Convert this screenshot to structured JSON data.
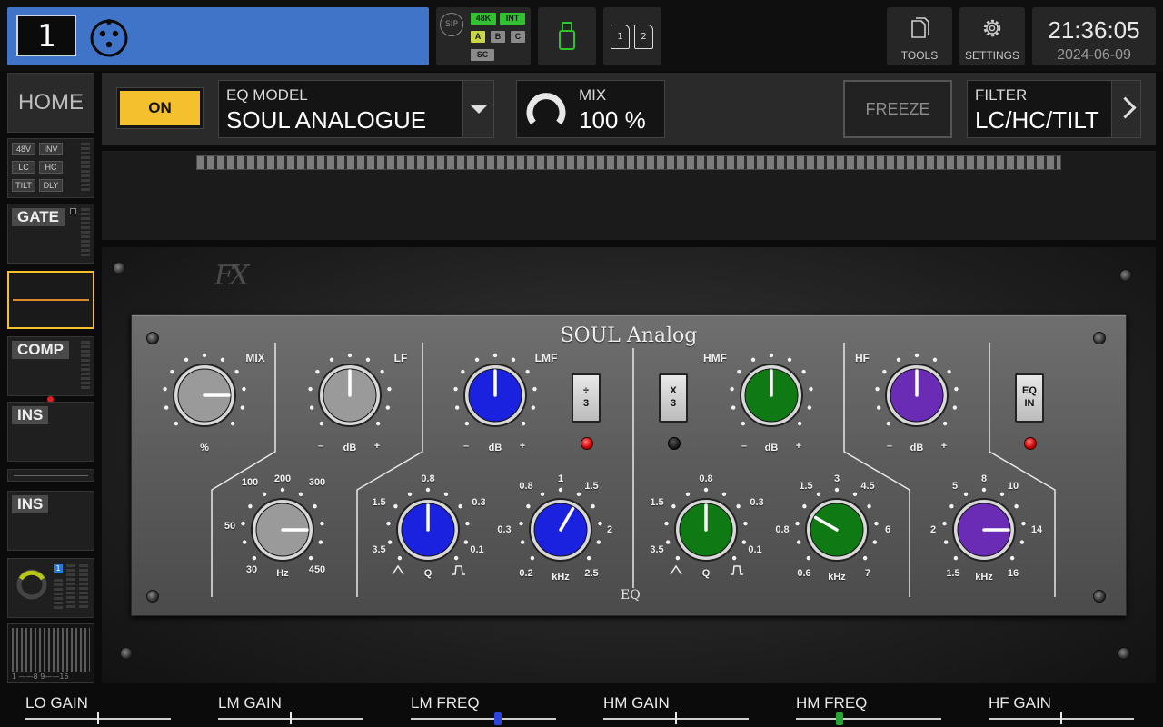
{
  "header": {
    "channel_number": "1",
    "sip_logo": "SIP",
    "chips": {
      "rate": "48K",
      "clock": "INT",
      "a": "A",
      "b": "B",
      "c": "C",
      "sc": "SC"
    },
    "sd_slots": [
      "1",
      "2"
    ],
    "tools_label": "TOOLS",
    "settings_label": "SETTINGS",
    "time": "21:36:05",
    "date": "2024-06-09"
  },
  "sidebar": {
    "home_label": "HOME",
    "input_tags": [
      "48V",
      "INV",
      "LC",
      "HC",
      "TILT",
      "DLY"
    ],
    "gate_label": "GATE",
    "comp_label": "COMP",
    "ins1_label": "INS",
    "ins2_label": "INS",
    "dca_badge": "1",
    "meter_scale": "1 ——8 9——16"
  },
  "toolbar": {
    "on_label": "ON",
    "model_caption": "EQ MODEL",
    "model_value": "SOUL ANALOGUE",
    "mix_caption": "MIX",
    "mix_value": "100 %",
    "freeze_label": "FREEZE",
    "filter_caption": "FILTER",
    "filter_value": "LC/HC/TILT"
  },
  "plugin": {
    "brand": "FX",
    "title": "SOUL Analog",
    "footer": "EQ",
    "sections": {
      "mix": "MIX",
      "lf": "LF",
      "lmf": "LMF",
      "hmf": "HMF",
      "hf": "HF"
    },
    "mix_knob": {
      "unit": "%"
    },
    "lf_gain": {
      "minus": "–",
      "unit": "dB",
      "plus": "+"
    },
    "lmf_gain": {
      "minus": "–",
      "unit": "dB",
      "plus": "+"
    },
    "hmf_gain": {
      "minus": "–",
      "unit": "dB",
      "plus": "+"
    },
    "hf_gain": {
      "minus": "–",
      "unit": "dB",
      "plus": "+"
    },
    "lf_freq": {
      "ticks": [
        "100",
        "200",
        "300",
        "50",
        "30",
        "450"
      ],
      "unit": "Hz"
    },
    "lmf_q": {
      "ticks": [
        "0.8",
        "1.5",
        "0.3",
        "3.5",
        "0.1"
      ],
      "unit": "Q"
    },
    "lmf_freq": {
      "ticks": [
        "0.8",
        "1",
        "1.5",
        "0.3",
        "2",
        "0.2",
        "2.5"
      ],
      "unit": "kHz"
    },
    "hmf_q": {
      "ticks": [
        "0.8",
        "1.5",
        "0.3",
        "3.5",
        "0.1"
      ],
      "unit": "Q"
    },
    "hmf_freq": {
      "ticks": [
        "1.5",
        "3",
        "4.5",
        "0.8",
        "6",
        "0.6",
        "7"
      ],
      "unit": "kHz"
    },
    "hf_freq": {
      "ticks": [
        "5",
        "8",
        "10",
        "2",
        "14",
        "1.5",
        "16"
      ],
      "unit": "kHz"
    },
    "div3_label": "÷\n3",
    "x3_label": "X\n3",
    "eqin_label": "EQ\nIN",
    "colors": {
      "blue": "#1a22e0",
      "green": "#0f7a14",
      "purple": "#6a2bb5",
      "grey": "#9a9a9a",
      "led_red": "#e01010"
    }
  },
  "bottom": {
    "params": [
      {
        "label": "LO GAIN",
        "value_fraction": 0.5
      },
      {
        "label": "LM GAIN",
        "value_fraction": 0.5
      },
      {
        "label": "LM FREQ",
        "value_fraction": 0.6
      },
      {
        "label": "HM GAIN",
        "value_fraction": 0.5
      },
      {
        "label": "HM FREQ",
        "value_fraction": 0.3
      },
      {
        "label": "HF GAIN",
        "value_fraction": 0.5
      }
    ]
  }
}
